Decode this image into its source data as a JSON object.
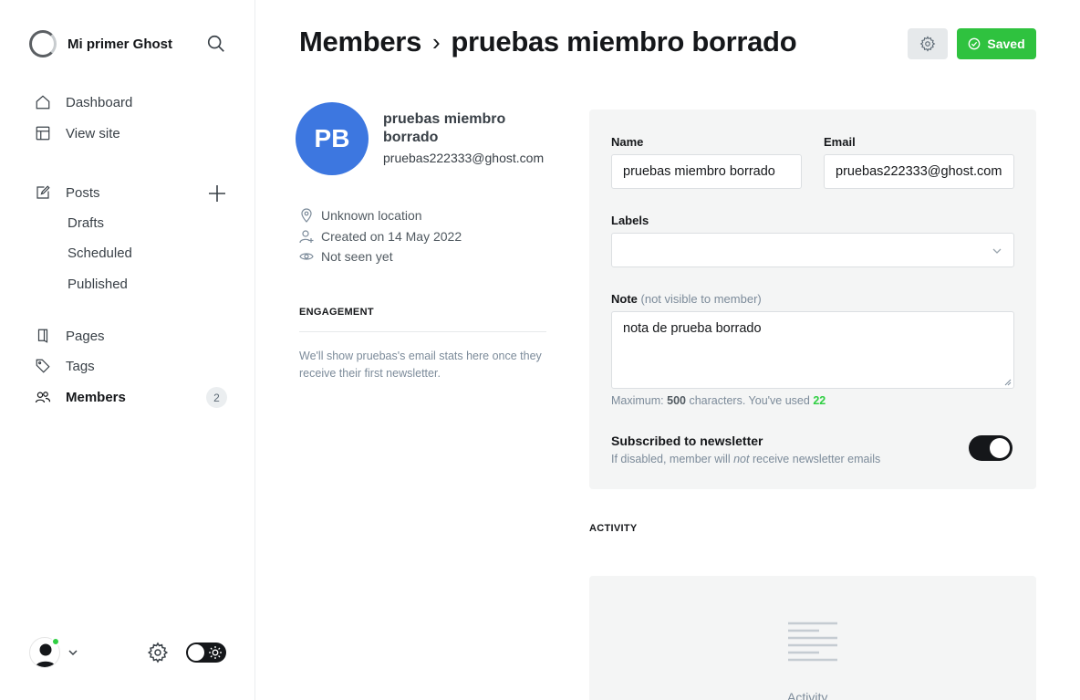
{
  "app": {
    "site_name": "Mi primer Ghost"
  },
  "sidebar": {
    "items": [
      {
        "label": "Dashboard",
        "icon": "home-icon"
      },
      {
        "label": "View site",
        "icon": "layout-icon"
      },
      {
        "label": "Posts",
        "icon": "pen-icon"
      },
      {
        "label": "Pages",
        "icon": "page-icon"
      },
      {
        "label": "Tags",
        "icon": "tag-icon"
      },
      {
        "label": "Members",
        "icon": "members-icon",
        "count": "2"
      }
    ],
    "post_subitems": [
      "Drafts",
      "Scheduled",
      "Published"
    ]
  },
  "header": {
    "breadcrumb_parent": "Members",
    "breadcrumb_sep": "›",
    "title": "pruebas miembro borrado",
    "saved_label": "Saved"
  },
  "member": {
    "initials": "PB",
    "name": "pruebas miembro borrado",
    "email": "pruebas222333@ghost.com",
    "location": "Unknown location",
    "created": "Created on 14 May 2022",
    "last_seen": "Not seen yet"
  },
  "engagement": {
    "title": "ENGAGEMENT",
    "text": "We'll show pruebas's email stats here once they receive their first newsletter."
  },
  "form": {
    "name_label": "Name",
    "name_value": "pruebas miembro borrado",
    "email_label": "Email",
    "email_value": "pruebas222333@ghost.com",
    "labels_label": "Labels",
    "labels_value": "",
    "note_label": "Note",
    "note_hint": "(not visible to member)",
    "note_value": "nota de prueba borrado",
    "char_prefix": "Maximum:",
    "char_max": "500",
    "char_mid": "characters. You've used",
    "char_used": "22",
    "newsletter_title": "Subscribed to newsletter",
    "newsletter_desc_pre": "If disabled, member will",
    "newsletter_desc_em": "not",
    "newsletter_desc_post": "receive newsletter emails",
    "newsletter_enabled": true
  },
  "activity": {
    "title": "ACTIVITY",
    "empty_label": "Activity"
  },
  "colors": {
    "accent_green": "#30cf43",
    "avatar_blue": "#3d77e0",
    "dark": "#15171a"
  }
}
